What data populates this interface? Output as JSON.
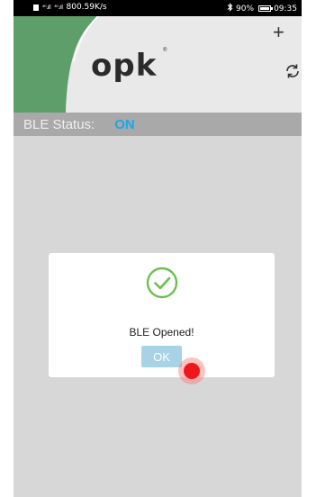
{
  "status_bar": {
    "signal_1": "⁴ᴳ.ıll",
    "signal_2": "⁴ᴳ.ıll",
    "net_speed": "800.59K/s",
    "bluetooth_icon": "bluetooth-icon",
    "battery": "90%",
    "time": "09:35"
  },
  "header": {
    "logo_text": "opk",
    "logo_mark": "®",
    "add_icon": "plus-icon",
    "refresh_icon": "refresh-icon"
  },
  "ble": {
    "label": "BLE Status:",
    "value": "ON"
  },
  "dialog": {
    "icon": "check-circle-icon",
    "message": "BLE Opened!",
    "ok_label": "OK"
  },
  "colors": {
    "accent_blue": "#1ba7e8",
    "header_green": "#5e9e6a",
    "success_green": "#6bbf52",
    "ok_button": "#a8d3e6",
    "tap_red": "#f0171c"
  }
}
